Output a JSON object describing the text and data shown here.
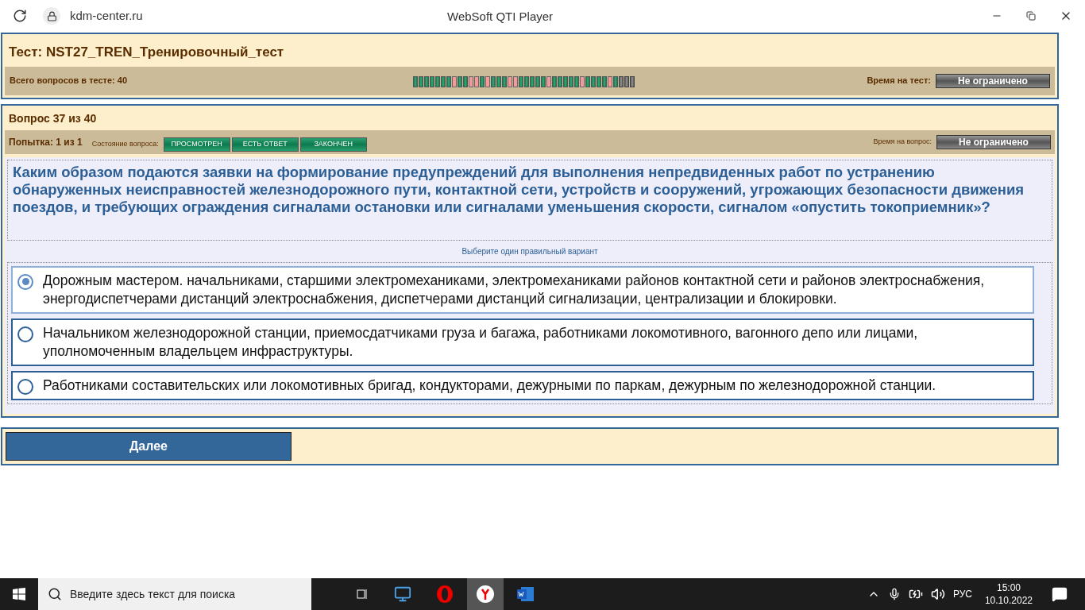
{
  "browser": {
    "address": "kdm-center.ru",
    "title": "WebSoft QTI Player"
  },
  "test": {
    "title": "Тест: NST27_TREN_Тренировочный_тест",
    "total": "Всего вопросов в тесте: 40",
    "time_label": "Время на тест:",
    "time_value": "Не ограничено",
    "progress": [
      {
        "kind": "ok"
      },
      {
        "kind": "ok"
      },
      {
        "kind": "ok"
      },
      {
        "kind": "ok"
      },
      {
        "kind": "ok"
      },
      {
        "kind": "ok"
      },
      {
        "kind": "ok"
      },
      {
        "kind": "error"
      },
      {
        "kind": "ok"
      },
      {
        "kind": "ok"
      },
      {
        "kind": "error"
      },
      {
        "kind": "error"
      },
      {
        "kind": "ok"
      },
      {
        "kind": "error"
      },
      {
        "kind": "ok"
      },
      {
        "kind": "ok"
      },
      {
        "kind": "ok"
      },
      {
        "kind": "error"
      },
      {
        "kind": "error"
      },
      {
        "kind": "ok"
      },
      {
        "kind": "ok"
      },
      {
        "kind": "ok"
      },
      {
        "kind": "ok"
      },
      {
        "kind": "ok"
      },
      {
        "kind": "error"
      },
      {
        "kind": "ok"
      },
      {
        "kind": "ok"
      },
      {
        "kind": "ok"
      },
      {
        "kind": "ok"
      },
      {
        "kind": "ok"
      },
      {
        "kind": "error"
      },
      {
        "kind": "ok"
      },
      {
        "kind": "ok"
      },
      {
        "kind": "ok"
      },
      {
        "kind": "ok"
      },
      {
        "kind": "error"
      },
      {
        "kind": "ok"
      },
      {
        "kind": "none"
      },
      {
        "kind": "none"
      },
      {
        "kind": "none"
      }
    ]
  },
  "question": {
    "header": "Вопрос 37 из 40",
    "attempt": "Попытка: 1 из 1",
    "state_label": "Состояние вопроса:",
    "states": [
      {
        "label": "ПРОСМОТРЕН",
        "on": true
      },
      {
        "label": "ЕСТЬ ОТВЕТ",
        "on": true
      },
      {
        "label": "ЗАКОНЧЕН",
        "on": true
      }
    ],
    "time_label": "Время на вопрос:",
    "time_value": "Не ограничено",
    "text": "Каким образом подаются заявки на формирование предупреждений для выполнения непредвиденных работ по устранению обнаруженных неисправностей железнодорожного пути, контактной сети, устройств и сооружений, угрожающих безопасности движения поездов, и требующих ограждения сигналами остановки или сигналами уменьшения скорости, сигналом «опустить токоприемник»?",
    "hint": "Выберите один правильный вариант",
    "options": [
      {
        "text": "Дорожным мастером. начальниками, старшими электромеханиками, электромеханиками районов контактной сети и районов электроснабжения, энергодиспетчерами дистанций электроснабжения, диспетчерами дистанций сигнализации, централизации и блокировки.",
        "selected": true
      },
      {
        "text": "Начальником железнодорожной станции, приемосдатчиками груза и багажа, работниками локомотивного, вагонного депо или лицами, уполномоченным владельцем инфраструктуры.",
        "selected": false
      },
      {
        "text": "Работниками составительских или локомотивных бригад, кондукторами, дежурными по паркам, дежурным по железнодорожной станции.",
        "selected": false
      }
    ]
  },
  "next_button": "Далее",
  "taskbar": {
    "search_placeholder": "Введите здесь текст для поиска",
    "language": "РУС",
    "time": "15:00",
    "date": "10.10.2022"
  }
}
